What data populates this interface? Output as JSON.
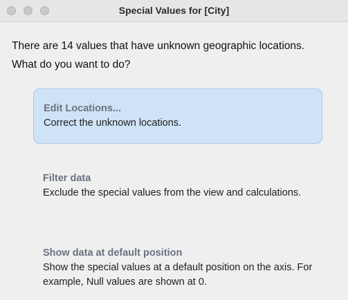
{
  "window": {
    "title": "Special Values for [City]"
  },
  "prompt": {
    "line1": "There are 14 values that have unknown geographic locations.",
    "line2": "What do you want to do?"
  },
  "options": [
    {
      "title": "Edit Locations...",
      "description": "Correct the unknown locations."
    },
    {
      "title": "Filter data",
      "description": "Exclude the special values from the view and calculations."
    },
    {
      "title": "Show data at default position",
      "description": "Show the special values at a default position on the axis. For example, Null values are shown at 0."
    }
  ],
  "colors": {
    "selected_bg": "#cfe3f7",
    "selected_border": "#a9c8e8",
    "option_title": "#6a7282"
  }
}
